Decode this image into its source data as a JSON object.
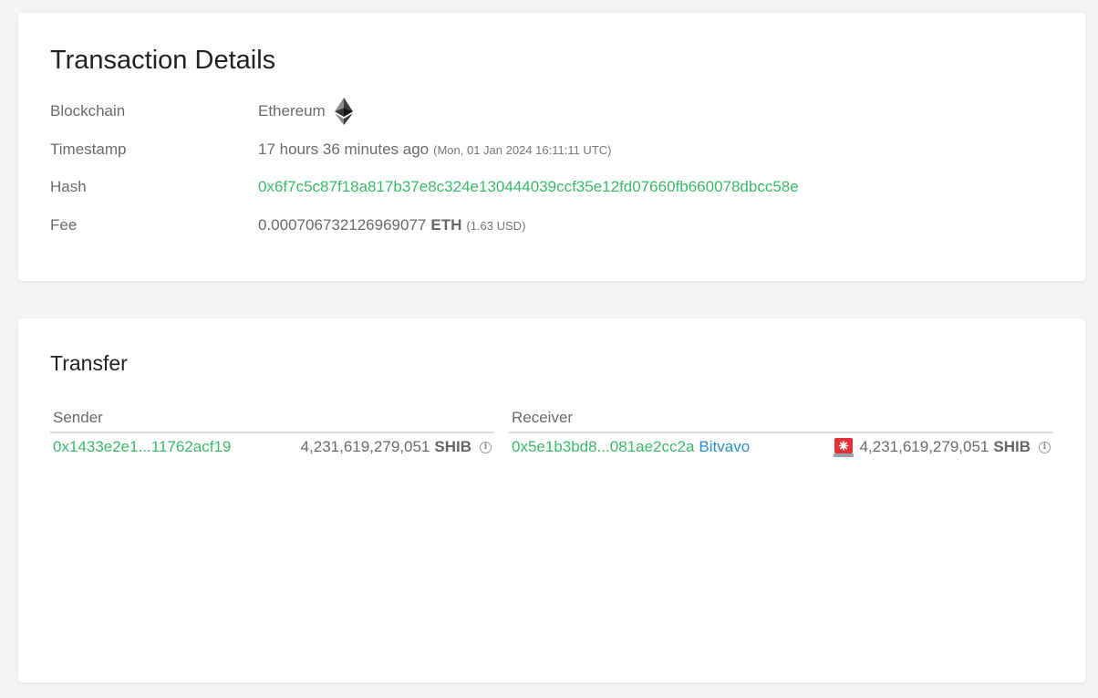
{
  "details": {
    "title": "Transaction Details",
    "rows": {
      "blockchain": {
        "label": "Blockchain",
        "value": "Ethereum"
      },
      "timestamp": {
        "label": "Timestamp",
        "relative": "17 hours 36 minutes ago",
        "absolute": "(Mon, 01 Jan 2024 16:11:11 UTC)"
      },
      "hash": {
        "label": "Hash",
        "value": "0x6f7c5c87f18a817b37e8c324e130444039ccf35e12fd07660fb660078dbcc58e"
      },
      "fee": {
        "label": "Fee",
        "amount": "0.000706732126969077",
        "unit": "ETH",
        "usd": "(1.63 USD)"
      }
    }
  },
  "transfer": {
    "title": "Transfer",
    "sender": {
      "header": "Sender",
      "address": "0x1433e2e1...11762acf19",
      "amount": "4,231,619,279,051",
      "token": "SHIB"
    },
    "receiver": {
      "header": "Receiver",
      "address": "0x5e1b3bd8...081ae2cc2a",
      "entity": "Bitvavo",
      "amount": "4,231,619,279,051",
      "token": "SHIB"
    }
  },
  "icons": {
    "blockchain": "ethereum-icon",
    "info": "info-icon",
    "alert": "siren-icon"
  },
  "colors": {
    "link_green": "#3cb96a",
    "entity_blue": "#2a8fc8",
    "alert_red": "#e0303a"
  }
}
